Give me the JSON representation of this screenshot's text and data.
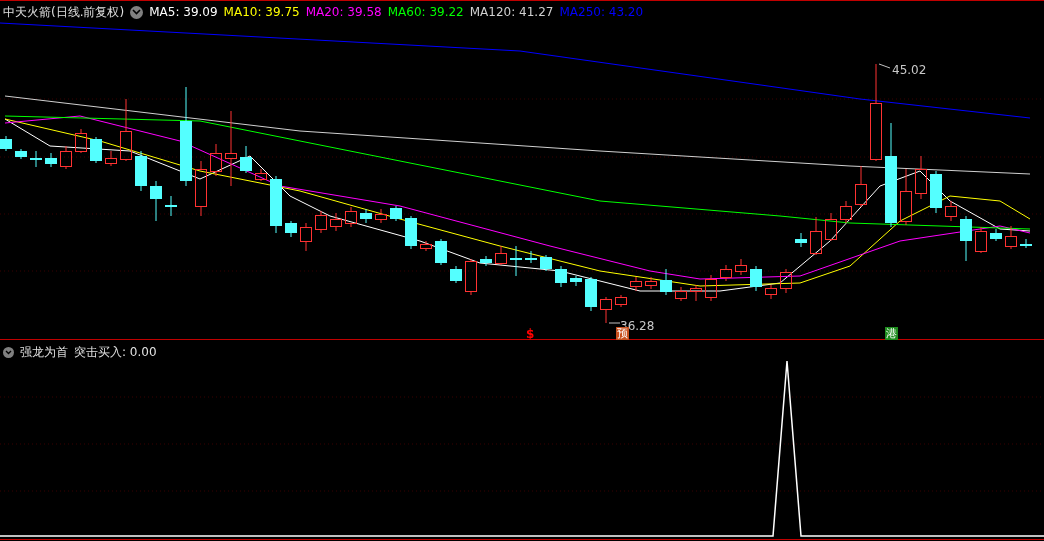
{
  "header": {
    "title": "中天火箭",
    "period": "(日线.前复权)"
  },
  "moving_averages": [
    {
      "label": "MA5:",
      "value": "39.09",
      "color": "#ffffff"
    },
    {
      "label": "MA10:",
      "value": "39.75",
      "color": "#ffff00"
    },
    {
      "label": "MA20:",
      "value": "39.58",
      "color": "#ff00ff"
    },
    {
      "label": "MA60:",
      "value": "39.22",
      "color": "#00ff00"
    },
    {
      "label": "MA120:",
      "value": "41.27",
      "color": "#d0d0d0"
    },
    {
      "label": "MA250:",
      "value": "43.20",
      "color": "#0000ff"
    }
  ],
  "price_marks": [
    {
      "kind": "high",
      "text": "45.02"
    },
    {
      "kind": "low",
      "text": "36.28"
    }
  ],
  "events": [
    {
      "kind": "text",
      "text": "$",
      "color": "#ff0000"
    },
    {
      "kind": "badge",
      "text": "预",
      "color": "#c8501e"
    },
    {
      "kind": "badge",
      "text": "港",
      "color": "#1e8c1e"
    }
  ],
  "indicator": {
    "name": "强龙为首",
    "line_label": "突击买入:",
    "value": "0.00"
  }
}
